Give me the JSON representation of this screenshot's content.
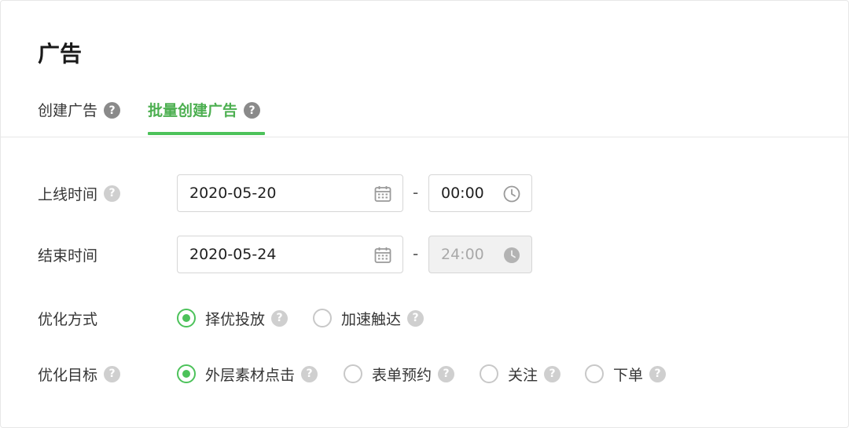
{
  "page": {
    "title": "广告"
  },
  "tabs": [
    {
      "label": "创建广告",
      "help": "?"
    },
    {
      "label": "批量创建广告",
      "help": "?",
      "active": true
    }
  ],
  "colors": {
    "accent": "#4cc25a",
    "border": "#d6d6d6",
    "help_icon": "#8a8a8a"
  },
  "form": {
    "online_time": {
      "label": "上线时间",
      "help": "?",
      "date": "2020-05-20",
      "separator": "-",
      "time": "00:00",
      "date_icon": "calendar-icon",
      "time_icon": "clock-icon"
    },
    "end_time": {
      "label": "结束时间",
      "date": "2020-05-24",
      "separator": "-",
      "time": "24:00",
      "time_disabled": true,
      "date_icon": "calendar-icon",
      "time_icon": "clock-icon"
    },
    "optimize_method": {
      "label": "优化方式",
      "options": [
        {
          "label": "择优投放",
          "help": "?",
          "checked": true
        },
        {
          "label": "加速触达",
          "help": "?",
          "checked": false
        }
      ]
    },
    "optimize_goal": {
      "label": "优化目标",
      "help": "?",
      "options": [
        {
          "label": "外层素材点击",
          "help": "?",
          "checked": true
        },
        {
          "label": "表单预约",
          "help": "?",
          "checked": false
        },
        {
          "label": "关注",
          "help": "?",
          "checked": false
        },
        {
          "label": "下单",
          "help": "?",
          "checked": false
        }
      ]
    }
  }
}
